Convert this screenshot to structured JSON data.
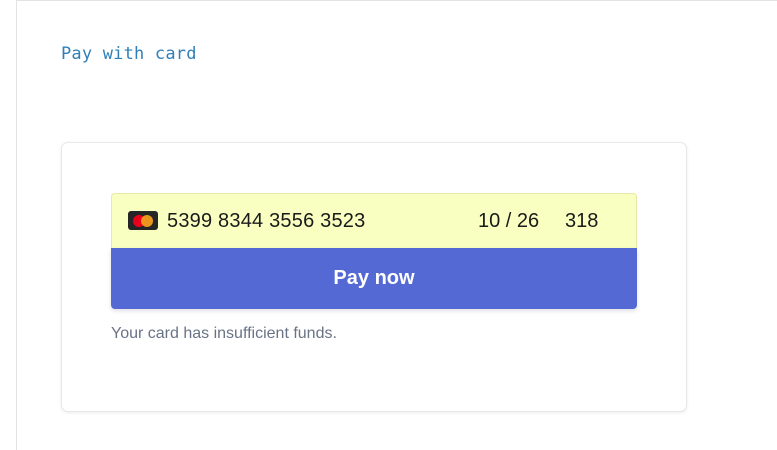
{
  "page": {
    "title": "Pay with card"
  },
  "payment_form": {
    "card_brand_icon": "mastercard-icon",
    "card_number": "5399 8344 3556 3523",
    "expiry": "10 / 26",
    "cvc": "318",
    "pay_button_label": "Pay now",
    "error_message": "Your card has insufficient funds."
  },
  "colors": {
    "title": "#2f7fb8",
    "card_field_background": "#f8ffc0",
    "pay_button": "#5469d4",
    "error_text": "#697386"
  }
}
